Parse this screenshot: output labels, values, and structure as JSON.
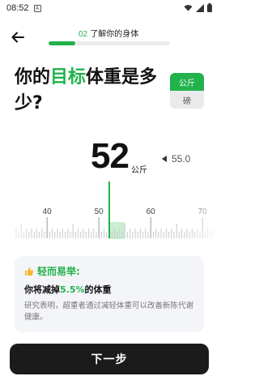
{
  "status_bar": {
    "time": "08:52",
    "notif_glyph": "A"
  },
  "header": {
    "step_number": "02",
    "step_title": "了解你的身体",
    "progress_fraction": 0.22
  },
  "question": {
    "part1": "你的",
    "highlight": "目标",
    "part2": "体重是多少?"
  },
  "unit_toggle": {
    "options": [
      "公斤",
      "磅"
    ],
    "selected": "公斤"
  },
  "weight": {
    "value": "52",
    "unit": "公斤",
    "previous": "55.0"
  },
  "ruler": {
    "min": 34,
    "max": 72,
    "selected": 52,
    "ticks": [
      {
        "value": 40,
        "label": "40"
      },
      {
        "value": 50,
        "label": "50"
      },
      {
        "value": 60,
        "label": "60"
      },
      {
        "value": 70,
        "label": "70"
      }
    ]
  },
  "tip": {
    "title": "轻而易举:",
    "main_prefix": "你将减掉",
    "main_highlight": "5.5%",
    "main_suffix": "的体重",
    "body": "研究表明，超重者通过减轻体重可以改善新陈代谢健康。"
  },
  "footer": {
    "next_label": "下一步"
  },
  "colors": {
    "accent": "#22b24c",
    "button_bg": "#1b1b1b"
  }
}
